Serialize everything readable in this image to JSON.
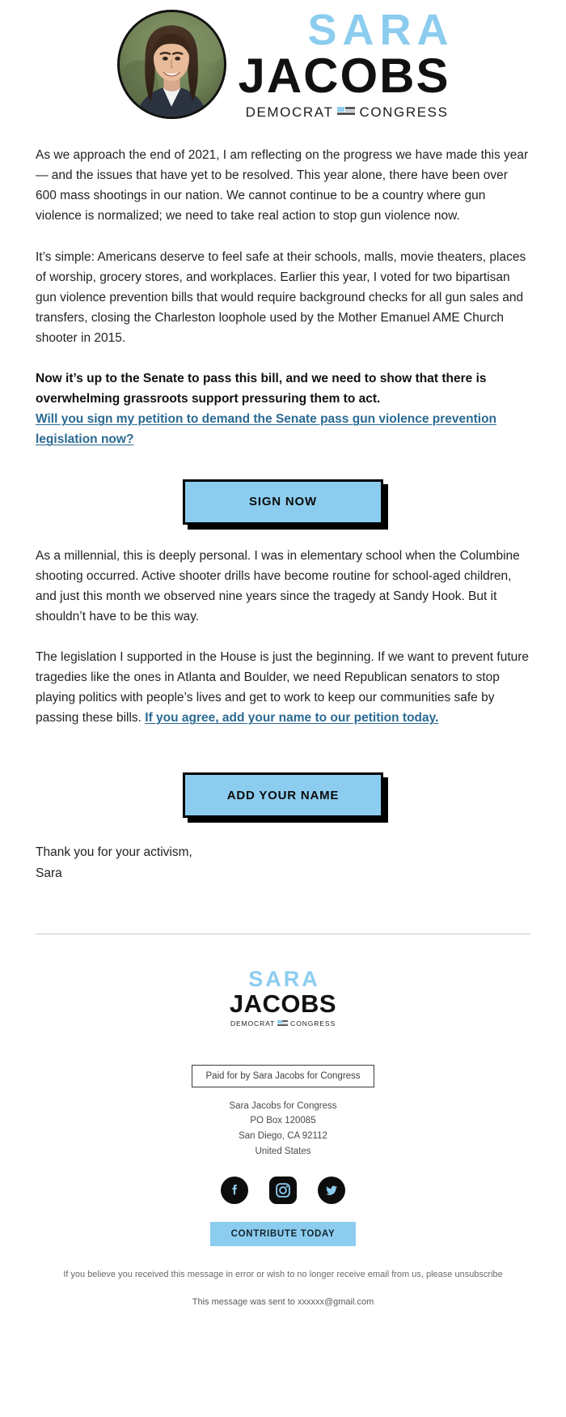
{
  "header": {
    "avatar_alt": "Sara Jacobs portrait",
    "logo": {
      "first_name": "SARA",
      "last_name": "JACOBS",
      "tagline_left": "DEMOCRAT",
      "tagline_right": "CONGRESS"
    }
  },
  "body": {
    "paragraph_1": "As we approach the end of 2021, I am reflecting on the progress we have made this year — and the issues that have yet to be resolved. This year alone, there have been over 600 mass shootings in our nation. We cannot continue to be a country where gun violence is normalized; we need to take real action to stop gun violence now.",
    "paragraph_2": "It’s simple: Americans deserve to feel safe at their schools, malls, movie theaters, places of worship, grocery stores, and workplaces. Earlier this year, I voted for two bipartisan gun violence prevention bills that would require background checks for all gun sales and transfers, closing the Charleston loophole used by the Mother Emanuel AME Church shooter in 2015.",
    "paragraph_3_bold": "Now it’s up to the Senate to pass this bill, and we need to show that there is overwhelming grassroots support pressuring them to act.",
    "link_1": "Will you sign my petition to demand the Senate pass gun violence prevention legislation now?",
    "cta_1": "SIGN NOW",
    "paragraph_4": "As a millennial, this is deeply personal. I was in elementary school when the Columbine shooting occurred. Active shooter drills have become routine for school-aged children, and just this month we observed nine years since the tragedy at Sandy Hook. But it shouldn’t have to be this way.",
    "paragraph_5_part1": "The legislation I supported in the House is just the beginning. If we want to prevent future tragedies like the ones in Atlanta and Boulder, we need Republican senators to stop playing politics with people’s lives and get to work to keep our communities safe by passing these bills. ",
    "link_2": "If you agree, add your name to our petition today.",
    "cta_2": "ADD YOUR NAME",
    "signoff_line_1": "Thank you for your activism,",
    "signoff_line_2": "Sara"
  },
  "footer": {
    "logo": {
      "first_name": "SARA",
      "last_name": "JACOBS",
      "tagline_left": "DEMOCRAT",
      "tagline_right": "CONGRESS"
    },
    "paid_for": "Paid for by Sara Jacobs for Congress",
    "address_lines": [
      "Sara Jacobs for Congress",
      "PO Box 120085",
      "San Diego, CA 92112",
      "United States"
    ],
    "social": [
      {
        "name": "facebook-icon",
        "label": "Facebook"
      },
      {
        "name": "instagram-icon",
        "label": "Instagram"
      },
      {
        "name": "twitter-icon",
        "label": "Twitter"
      }
    ],
    "contribute_label": "CONTRIBUTE TODAY",
    "legal_text": "If you believe you received this message in error or wish to no longer receive email from us, please ",
    "unsubscribe_label": "unsubscribe",
    "sent_to": "This message was sent to xxxxxx@gmail.com"
  },
  "colors": {
    "brand_blue": "#8ccdef",
    "link_blue": "#2a6a93",
    "black": "#000000"
  }
}
